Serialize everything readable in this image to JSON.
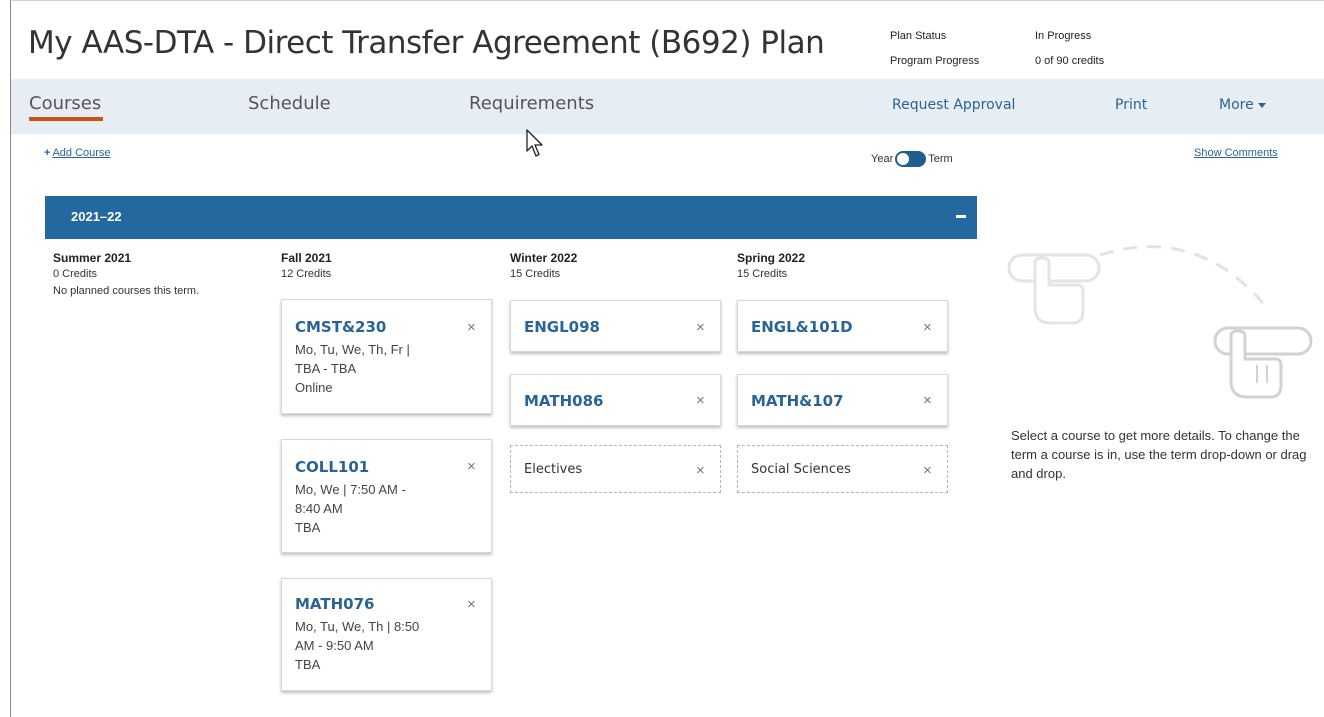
{
  "header": {
    "title": "My AAS-DTA - Direct Transfer Agreement (B692) Plan",
    "status": [
      {
        "label": "Plan Status",
        "value": "In Progress"
      },
      {
        "label": "Program Progress",
        "value": "0 of 90 credits"
      }
    ]
  },
  "nav": {
    "tabs": [
      {
        "label": "Courses",
        "active": true
      },
      {
        "label": "Schedule",
        "active": false
      },
      {
        "label": "Requirements",
        "active": false
      }
    ],
    "actions": {
      "request_approval": "Request Approval",
      "print": "Print",
      "more": "More"
    }
  },
  "toolbar": {
    "add_course": "Add Course",
    "toggle_left": "Year",
    "toggle_right": "Term",
    "show_comments": "Show Comments"
  },
  "year": {
    "label": "2021–22",
    "collapse_icon": "minus-icon"
  },
  "terms": [
    {
      "name": "Summer 2021",
      "credits": "0 Credits",
      "empty_text": "No planned courses this term."
    },
    {
      "name": "Fall 2021",
      "credits": "12 Credits"
    },
    {
      "name": "Winter 2022",
      "credits": "15 Credits"
    },
    {
      "name": "Spring 2022",
      "credits": "15 Credits"
    }
  ],
  "courses": {
    "fall": [
      {
        "code": "CMST&230",
        "days": "Mo, Tu, We, Th, Fr |",
        "time": "TBA - TBA",
        "location": "Online"
      },
      {
        "code": "COLL101",
        "days": "Mo, We | 7:50 AM -",
        "time": "8:40 AM",
        "location": "TBA"
      },
      {
        "code": "MATH076",
        "days": "Mo, Tu, We, Th | 8:50",
        "time": "AM - 9:50 AM",
        "location": "TBA"
      }
    ],
    "winter": [
      {
        "code": "ENGL098"
      },
      {
        "code": "MATH086"
      },
      {
        "code": "Electives",
        "placeholder": true
      }
    ],
    "spring": [
      {
        "code": "ENGL&101D"
      },
      {
        "code": "MATH&107"
      },
      {
        "code": "Social Sciences",
        "placeholder": true
      }
    ]
  },
  "remove_glyph": "×",
  "detail_hint": "Select a course to get more details. To change the term a course is in, use the term drop-down or drag and drop.",
  "colors": {
    "year_bar": "#2468a0",
    "link": "#2a6496",
    "active_underline": "#c8531b",
    "nav_bg": "#e6eef4"
  }
}
